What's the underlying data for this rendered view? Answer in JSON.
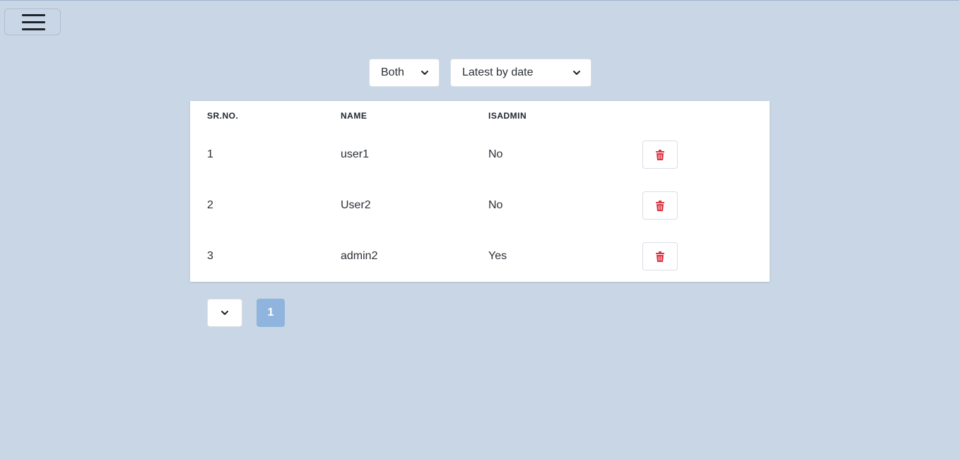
{
  "menu": {
    "icon": "hamburger-icon"
  },
  "filters": {
    "role_filter": {
      "value": "Both",
      "icon": "chevron-down-icon"
    },
    "sort_filter": {
      "value": "Latest by date",
      "icon": "chevron-down-icon"
    }
  },
  "table": {
    "columns": [
      "SR.NO.",
      "NAME",
      "ISADMIN"
    ],
    "rows": [
      {
        "srno": "1",
        "name": "user1",
        "isadmin": "No"
      },
      {
        "srno": "2",
        "name": "User2",
        "isadmin": "No"
      },
      {
        "srno": "3",
        "name": "admin2",
        "isadmin": "Yes"
      }
    ],
    "delete_icon": "trash-icon",
    "delete_color": "#dc3545"
  },
  "pagination": {
    "page_size_icon": "chevron-down-icon",
    "pages": [
      "1"
    ],
    "active_color": "#8fb4de"
  }
}
